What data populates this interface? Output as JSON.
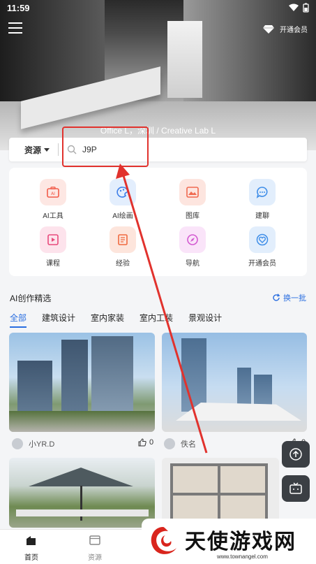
{
  "status": {
    "time": "11:59"
  },
  "header": {
    "vip_label": "开通会员",
    "caption": "Office L，深圳 / Creative Lab L"
  },
  "search": {
    "category": "资源",
    "query": "J9P"
  },
  "tools": [
    {
      "label": "AI工具",
      "icon": "ai-tool-icon",
      "color": "#f25c4a",
      "bg": "#fde7e3"
    },
    {
      "label": "AI绘画",
      "icon": "ai-paint-icon",
      "color": "#3f7fe8",
      "bg": "#e3eefd"
    },
    {
      "label": "图库",
      "icon": "gallery-icon",
      "color": "#f06a50",
      "bg": "#fde5df"
    },
    {
      "label": "建聊",
      "icon": "chat-icon",
      "color": "#3f8ee8",
      "bg": "#e2eefc"
    },
    {
      "label": "课程",
      "icon": "course-icon",
      "color": "#e84a7c",
      "bg": "#fde3ec"
    },
    {
      "label": "经验",
      "icon": "book-icon",
      "color": "#f06a40",
      "bg": "#fde5dc"
    },
    {
      "label": "导航",
      "icon": "compass-icon",
      "color": "#d35ad1",
      "bg": "#fae4f9"
    },
    {
      "label": "开通会员",
      "icon": "vip-heart-icon",
      "color": "#3f8ee8",
      "bg": "#e2eefc"
    }
  ],
  "section": {
    "title": "AI创作精选",
    "refresh_label": "换一批",
    "tabs": [
      "全部",
      "建筑设计",
      "室内家装",
      "室内工装",
      "景观设计"
    ],
    "active_tab": 0
  },
  "cards": [
    {
      "author": "小YR.D",
      "likes": "0"
    },
    {
      "author": "佚名",
      "likes": "0"
    }
  ],
  "bottom_nav": [
    {
      "label": "首页",
      "icon": "home-building-icon",
      "active": true
    },
    {
      "label": "资源",
      "icon": "folder-icon",
      "active": false
    }
  ],
  "watermark": {
    "text": "天使游戏网",
    "url": "www.townangel.com"
  },
  "colors": {
    "accent": "#2a6ee0",
    "annotation": "#e1322d"
  }
}
